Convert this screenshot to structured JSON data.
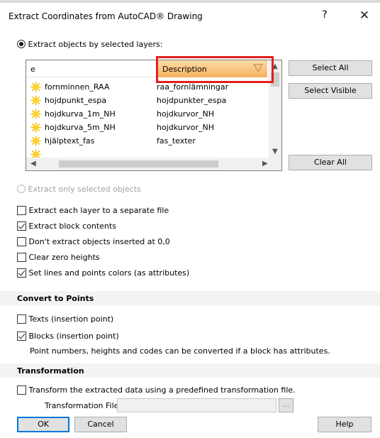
{
  "window": {
    "title": "Extract Coordinates from AutoCAD® Drawing",
    "help_glyph": "?",
    "close_glyph": "✕"
  },
  "mode": {
    "by_layers_label": "Extract objects by selected layers:",
    "by_layers_selected": true,
    "only_selected_label": "Extract only selected objects",
    "only_selected_enabled": false
  },
  "layer_list": {
    "columns": [
      "e",
      "Description"
    ],
    "rows": [
      {
        "name": "fornminnen_RAA",
        "description": "raa_fornlämningar"
      },
      {
        "name": "hojdpunkt_espa",
        "description": "hojdpunkter_espa"
      },
      {
        "name": "hojdkurva_1m_NH",
        "description": "hojdkurvor_NH"
      },
      {
        "name": "hojdkurva_5m_NH",
        "description": "hojdkurvor_NH"
      },
      {
        "name": "hjälptext_fas",
        "description": "fas_texter"
      }
    ],
    "icon": "layer-sun-icon"
  },
  "side_buttons": {
    "select_all": "Select All",
    "select_visible": "Select Visible",
    "clear_all": "Clear All"
  },
  "options": [
    {
      "label": "Extract each layer to a separate file",
      "checked": false
    },
    {
      "label": "Extract block contents",
      "checked": true
    },
    {
      "label": "Don't extract objects inserted at 0,0",
      "checked": false
    },
    {
      "label": "Clear zero heights",
      "checked": false
    },
    {
      "label": "Set lines and points colors (as attributes)",
      "checked": true
    }
  ],
  "convert": {
    "heading": "Convert to Points",
    "texts_label": "Texts (insertion point)",
    "texts_checked": false,
    "blocks_label": "Blocks (insertion point)",
    "blocks_checked": true,
    "note": "Point numbers, heights and codes can be converted if a block has attributes."
  },
  "transformation": {
    "heading": "Transformation",
    "transform_label": "Transform the extracted data using a predefined transformation file.",
    "transform_checked": false,
    "file_label": "Transformation File:",
    "file_value": "",
    "browse_label": "..."
  },
  "footer": {
    "ok": "OK",
    "cancel": "Cancel",
    "help": "Help"
  },
  "colors": {
    "header_highlight": "#f4b25e",
    "annotation_box": "#e02020",
    "default_button_border": "#0078d7"
  }
}
